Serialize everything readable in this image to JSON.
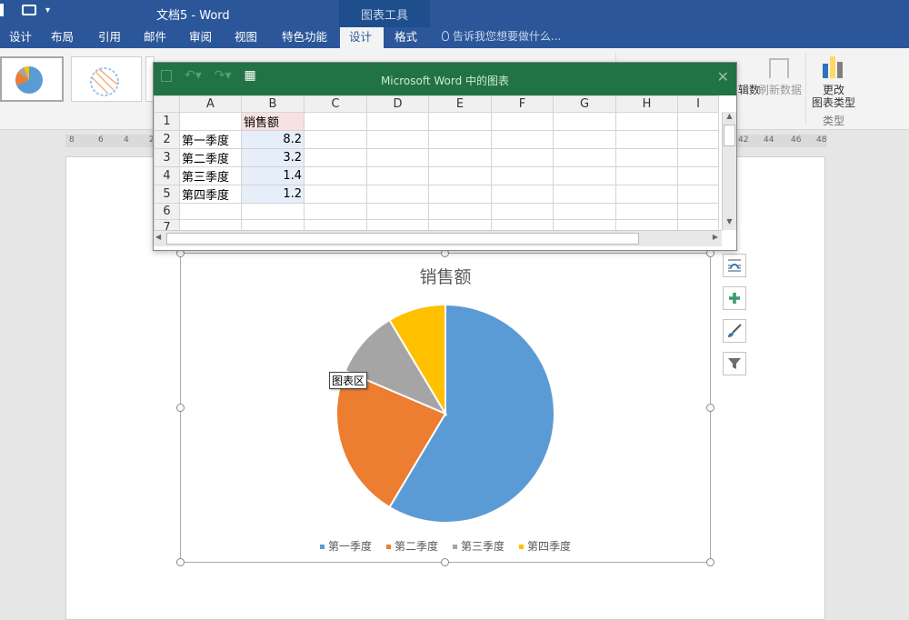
{
  "window": {
    "doc_title": "文档5 - Word",
    "contextual_group": "图表工具"
  },
  "tabs": [
    {
      "label": "设计"
    },
    {
      "label": "布局"
    },
    {
      "label": "引用"
    },
    {
      "label": "邮件"
    },
    {
      "label": "审阅"
    },
    {
      "label": "视图"
    },
    {
      "label": "特色功能"
    },
    {
      "label": "设计",
      "active": true
    },
    {
      "label": "格式"
    }
  ],
  "tell_me": {
    "placeholder": "告诉我您想要做什么..."
  },
  "ribbon": {
    "edit_data_partial": "辑数",
    "refresh_data": "刷新数据",
    "change_chart_type_line1": "更改",
    "change_chart_type_line2": "图表类型",
    "group_type": "类型"
  },
  "ruler": {
    "ticks": [
      "8",
      "6",
      "4",
      "2",
      "42",
      "44",
      "46",
      "48"
    ]
  },
  "spreadsheet": {
    "title": "Microsoft Word 中的图表",
    "columns": [
      "A",
      "B",
      "C",
      "D",
      "E",
      "F",
      "G",
      "H",
      "I"
    ],
    "rows": [
      {
        "n": "1",
        "a": "",
        "b": "销售额"
      },
      {
        "n": "2",
        "a": "第一季度",
        "b": "8.2"
      },
      {
        "n": "3",
        "a": "第二季度",
        "b": "3.2"
      },
      {
        "n": "4",
        "a": "第三季度",
        "b": "1.4"
      },
      {
        "n": "5",
        "a": "第四季度",
        "b": "1.2"
      },
      {
        "n": "6",
        "a": "",
        "b": ""
      },
      {
        "n": "7",
        "a": "",
        "b": ""
      }
    ]
  },
  "chart_tooltip": "图表区",
  "colors": {
    "word_blue": "#2b579a",
    "excel_green": "#217346",
    "q1": "#5b9bd5",
    "q2": "#ed7d31",
    "q3": "#a5a5a5",
    "q4": "#ffc000"
  },
  "chart_data": {
    "type": "pie",
    "title": "销售额",
    "categories": [
      "第一季度",
      "第二季度",
      "第三季度",
      "第四季度"
    ],
    "values": [
      8.2,
      3.2,
      1.4,
      1.2
    ],
    "colors": [
      "#5b9bd5",
      "#ed7d31",
      "#a5a5a5",
      "#ffc000"
    ],
    "legend_position": "bottom",
    "start_angle_deg": 0,
    "direction": "clockwise"
  }
}
